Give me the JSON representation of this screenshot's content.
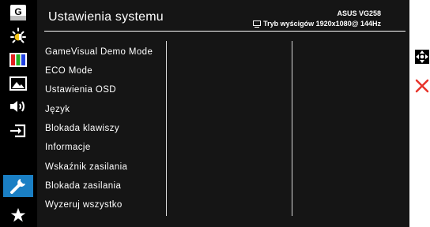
{
  "header": {
    "title": "Ustawienia systemu",
    "model": "ASUS VG258",
    "mode": "Tryb wyścigów 1920x1080@ 144Hz",
    "mode_icon": "monitor-icon"
  },
  "sidebar": {
    "items": [
      {
        "icon": "gamevisual-g-icon",
        "label": "G"
      },
      {
        "icon": "brightness-sun-icon"
      },
      {
        "icon": "color-bars-icon"
      },
      {
        "icon": "image-landscape-icon"
      },
      {
        "icon": "sound-speaker-icon"
      },
      {
        "icon": "input-select-icon"
      },
      {
        "icon": "wrench-icon",
        "active": true
      },
      {
        "icon": "star-icon"
      }
    ],
    "active_color": "#1a7fc4"
  },
  "menu": {
    "items": [
      "GameVisual Demo Mode",
      "ECO Mode",
      "Ustawienia OSD",
      "Język",
      "Blokada klawiszy",
      "Informacje",
      "Wskaźnik zasilania",
      "Blokada zasilania",
      "Wyzeruj wszystko"
    ]
  },
  "nav": {
    "move_icon": "four-way-arrow-icon",
    "close_icon": "close-x-icon",
    "close_color": "#e8332a"
  }
}
